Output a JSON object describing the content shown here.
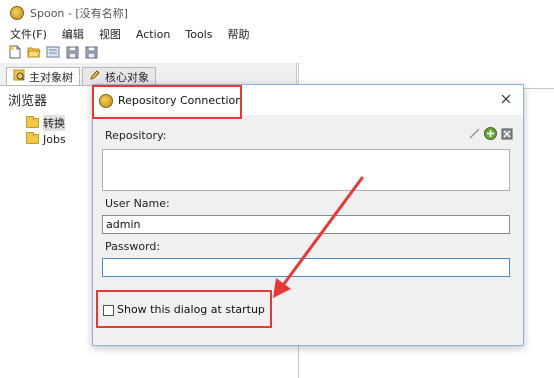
{
  "window": {
    "title": "Spoon - [没有名称]"
  },
  "menu": [
    "文件(F)",
    "编辑",
    "视图",
    "Action",
    "Tools",
    "帮助"
  ],
  "toolbar": [
    "new-file-icon",
    "open-folder-icon",
    "explore-icon",
    "save-icon",
    "save-as-icon"
  ],
  "tabs": [
    {
      "label": "主对象树",
      "icon": "tree-icon",
      "active": true
    },
    {
      "label": "核心对象",
      "icon": "pencil-icon",
      "active": false
    }
  ],
  "browser": {
    "title": "浏览器",
    "items": [
      {
        "label": "转换",
        "selected": true
      },
      {
        "label": "Jobs",
        "selected": false
      }
    ]
  },
  "dialog": {
    "title": "Repository Connection",
    "repository_label": "Repository:",
    "username_label": "User Name:",
    "username_value": "admin",
    "password_label": "Password:",
    "password_value": "",
    "startup_checkbox_label": "Show this dialog at startup",
    "startup_checked": false
  },
  "colors": {
    "annotation": "#e53935",
    "focus": "#4a8bc2"
  }
}
